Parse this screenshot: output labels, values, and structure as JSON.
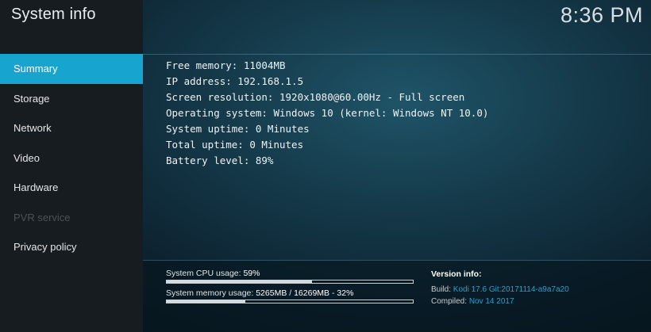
{
  "header": {
    "title": "System info",
    "clock": "8:36 PM"
  },
  "sidebar": {
    "items": [
      {
        "label": "Summary",
        "selected": true,
        "disabled": false
      },
      {
        "label": "Storage",
        "selected": false,
        "disabled": false
      },
      {
        "label": "Network",
        "selected": false,
        "disabled": false
      },
      {
        "label": "Video",
        "selected": false,
        "disabled": false
      },
      {
        "label": "Hardware",
        "selected": false,
        "disabled": false
      },
      {
        "label": "PVR service",
        "selected": false,
        "disabled": true
      },
      {
        "label": "Privacy policy",
        "selected": false,
        "disabled": false
      }
    ]
  },
  "summary": {
    "lines": [
      "Free memory: 11004MB",
      "IP address: 192.168.1.5",
      "Screen resolution: 1920x1080@60.00Hz - Full screen",
      "Operating system: Windows 10 (kernel: Windows NT 10.0)",
      "System uptime: 0 Minutes",
      "Total uptime: 0 Minutes",
      "Battery level: 89%"
    ]
  },
  "usage": {
    "cpu": {
      "label": "System CPU usage:",
      "value": "59%",
      "percent": 59
    },
    "memory": {
      "label": "System memory usage:",
      "used": "5265MB",
      "separator": "/",
      "total": "16269MB",
      "dash": "-",
      "percent_text": "32%",
      "percent": 32
    }
  },
  "version": {
    "heading": "Version info:",
    "build_label": "Build:",
    "build_value": "Kodi 17.6 Git:20171114-a9a7a20",
    "compiled_label": "Compiled:",
    "compiled_value": "Nov 14 2017"
  },
  "colors": {
    "accent": "#17a5cf",
    "sidebar_bg": "#171c20",
    "disabled_text": "#4b5257",
    "version_value": "#2a9ec9"
  }
}
